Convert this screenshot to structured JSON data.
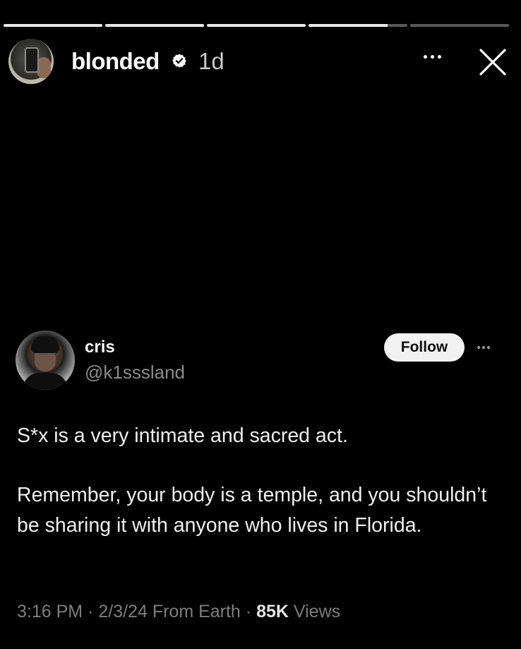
{
  "story": {
    "username": "blonded",
    "time_ago": "1d",
    "progress": [
      1,
      1,
      1,
      0.8,
      0
    ],
    "icons": {
      "verified": "verified-badge-icon",
      "more": "more-horizontal-icon",
      "close": "close-icon"
    }
  },
  "tweet": {
    "display_name": "cris",
    "handle": "@k1sssland",
    "follow_label": "Follow",
    "text_line1": "S*x is a very intimate and sacred act.",
    "text_line2": "Remember, your body is a temple, and you shouldn’t be sharing it with anyone who lives in Florida.",
    "meta": {
      "time": "3:16 PM",
      "date": "2/3/24",
      "location": "From Earth",
      "views_count": "85K",
      "views_label": "Views"
    }
  },
  "colors": {
    "background": "#000000",
    "text": "#ffffff",
    "muted": "#7d7d7d",
    "follow_bg": "#f2f2f2"
  }
}
